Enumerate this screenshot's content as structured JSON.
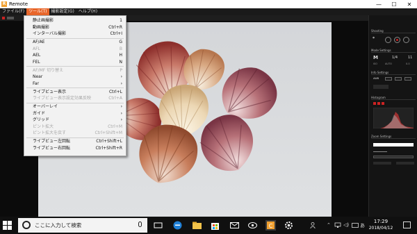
{
  "window": {
    "app_title": "Remote",
    "logo_letter": "R",
    "min_glyph": "—",
    "max_glyph": "☐",
    "close_glyph": "✕"
  },
  "menubar": {
    "items": [
      {
        "label": "ファイル(F)"
      },
      {
        "label": "ツール(T)"
      },
      {
        "label": "撮影設定(G)"
      },
      {
        "label": "ヘルプ(H)"
      }
    ]
  },
  "dropdown": {
    "items": [
      {
        "label": "静止画撮影",
        "shortcut": "1",
        "disabled": false
      },
      {
        "label": "動画撮影",
        "shortcut": "Ctrl+R",
        "disabled": false
      },
      {
        "label": "インターバル撮影",
        "shortcut": "Ctrl+I",
        "disabled": false
      },
      {
        "label": "AF/AE",
        "shortcut": "G",
        "disabled": false
      },
      {
        "label": "AFL",
        "shortcut": "B",
        "disabled": true
      },
      {
        "label": "AEL",
        "shortcut": "H",
        "disabled": false
      },
      {
        "label": "FEL",
        "shortcut": "N",
        "disabled": false
      },
      {
        "label": "AF/MF 切り替え",
        "shortcut": "P",
        "disabled": true
      },
      {
        "label": "Near",
        "shortcut": "›",
        "disabled": false
      },
      {
        "label": "Far",
        "shortcut": "›",
        "disabled": false
      },
      {
        "label": "ライブビュー表示",
        "shortcut": "Ctrl+L",
        "disabled": false
      },
      {
        "label": "ライブビュー表示設定効果反映",
        "shortcut": "Ctrl+A",
        "disabled": true
      },
      {
        "label": "オーバーレイ",
        "shortcut": "›",
        "disabled": false
      },
      {
        "label": "ガイド",
        "shortcut": "›",
        "disabled": false
      },
      {
        "label": "グリッド",
        "shortcut": "›",
        "disabled": false
      },
      {
        "label": "ピント拡大",
        "shortcut": "Ctrl+M",
        "disabled": true
      },
      {
        "label": "ピント拡大を戻す",
        "shortcut": "Ctrl+Shift+M",
        "disabled": true
      },
      {
        "label": "ライブビュー左回転",
        "shortcut": "Ctrl+Shift+L",
        "disabled": false
      },
      {
        "label": "ライブビュー右回転",
        "shortcut": "Ctrl+Shift+R",
        "disabled": false
      }
    ]
  },
  "right_panel": {
    "sections": [
      {
        "title": "Shooting"
      },
      {
        "title": "Mode Settings"
      },
      {
        "title": "Info Settings"
      },
      {
        "title": "Histogram"
      },
      {
        "title": "Zoom Settings"
      }
    ],
    "mode_letter": "M",
    "shutter": "1/4",
    "aperture": "11",
    "iso": "ISO",
    "iso_value": "AUTO",
    "wb_label": "AWB",
    "ev_value": "0.0"
  },
  "taskbar": {
    "search_placeholder": "ここに入力して検索",
    "time": "17:29",
    "date": "2018/04/12",
    "ime_label": "あ",
    "pinned_icons": [
      "task-view-icon",
      "edge-icon",
      "file-explorer-icon",
      "store-icon",
      "mail-icon",
      "photos-icon",
      "remote-app-icon",
      "settings-icon"
    ]
  },
  "colors": {
    "menu_active": "#e8662a",
    "accent_orange": "#f0a030",
    "record_red": "#cc2222"
  }
}
